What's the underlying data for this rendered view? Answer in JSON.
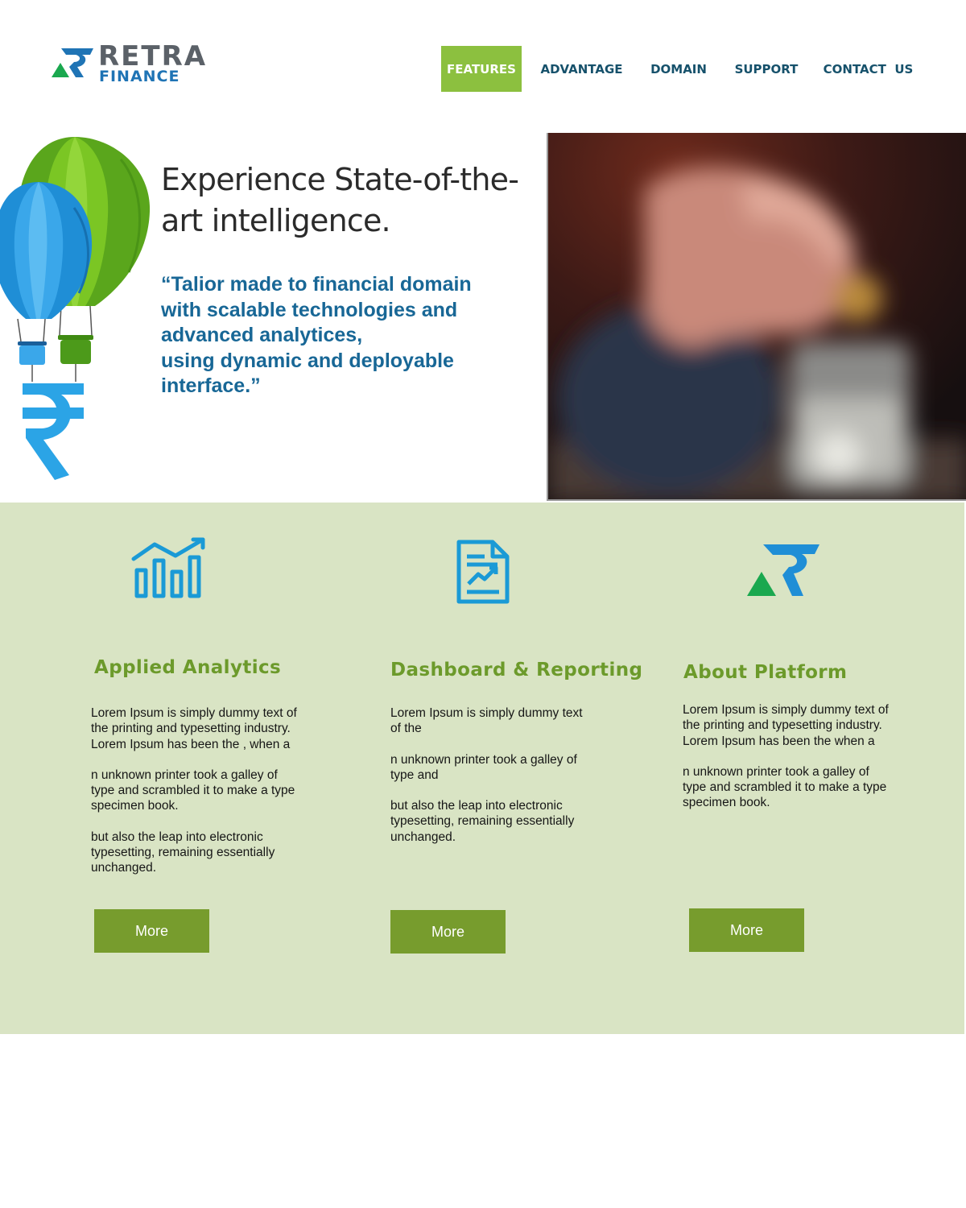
{
  "brand": {
    "name_top": "RETRA",
    "name_bottom": "FINANCE",
    "colors": {
      "logo_gray": "#5b6168",
      "logo_blue": "#1f74b5",
      "logo_green": "#1aa84f"
    }
  },
  "nav": {
    "items": [
      {
        "label": "FEATURES",
        "active": true
      },
      {
        "label": "ADVANTAGE",
        "active": false
      },
      {
        "label": "DOMAIN",
        "active": false
      },
      {
        "label": "SUPPORT",
        "active": false
      },
      {
        "label": "CONTACT  US",
        "active": false
      }
    ],
    "active_color": "#8cc03f",
    "text_color": "#16516b"
  },
  "hero": {
    "title": "Experience State-of-the-art intelligence.",
    "quote_lines": [
      "“Talior made to financial domain",
      "with scalable technologies and",
      "advanced analytices,",
      "using dynamic and deployable",
      "interface.”"
    ],
    "illustration_icons": [
      "hot-air-balloon-icon",
      "rupee-icon"
    ]
  },
  "features": {
    "background": "#d9e4c4",
    "title_color": "#6c9a2b",
    "button_color": "#779c2d",
    "items": [
      {
        "icon": "bar-chart-growth-icon",
        "title": "Applied Analytics",
        "paragraphs": [
          "Lorem Ipsum is simply dummy text of the printing and typesetting industry. Lorem Ipsum has been the , when a",
          "n unknown printer took a galley of type and scrambled it to make a type specimen book.",
          "but also the leap into electronic typesetting, remaining essentially unchanged."
        ],
        "button": "More"
      },
      {
        "icon": "report-document-icon",
        "title": "Dashboard & Reporting",
        "paragraphs": [
          "Lorem Ipsum is simply dummy text of the",
          "n unknown printer took a galley of type and",
          "but also the leap into electronic typesetting, remaining essentially unchanged."
        ],
        "button": "More"
      },
      {
        "icon": "retra-logo-icon",
        "title": "About Platform",
        "paragraphs": [
          "Lorem Ipsum is simply dummy text of the printing and typesetting industry. Lorem Ipsum has been the when a",
          "n unknown printer took a galley of type and scrambled it to make a type specimen book."
        ],
        "button": "More"
      }
    ]
  }
}
